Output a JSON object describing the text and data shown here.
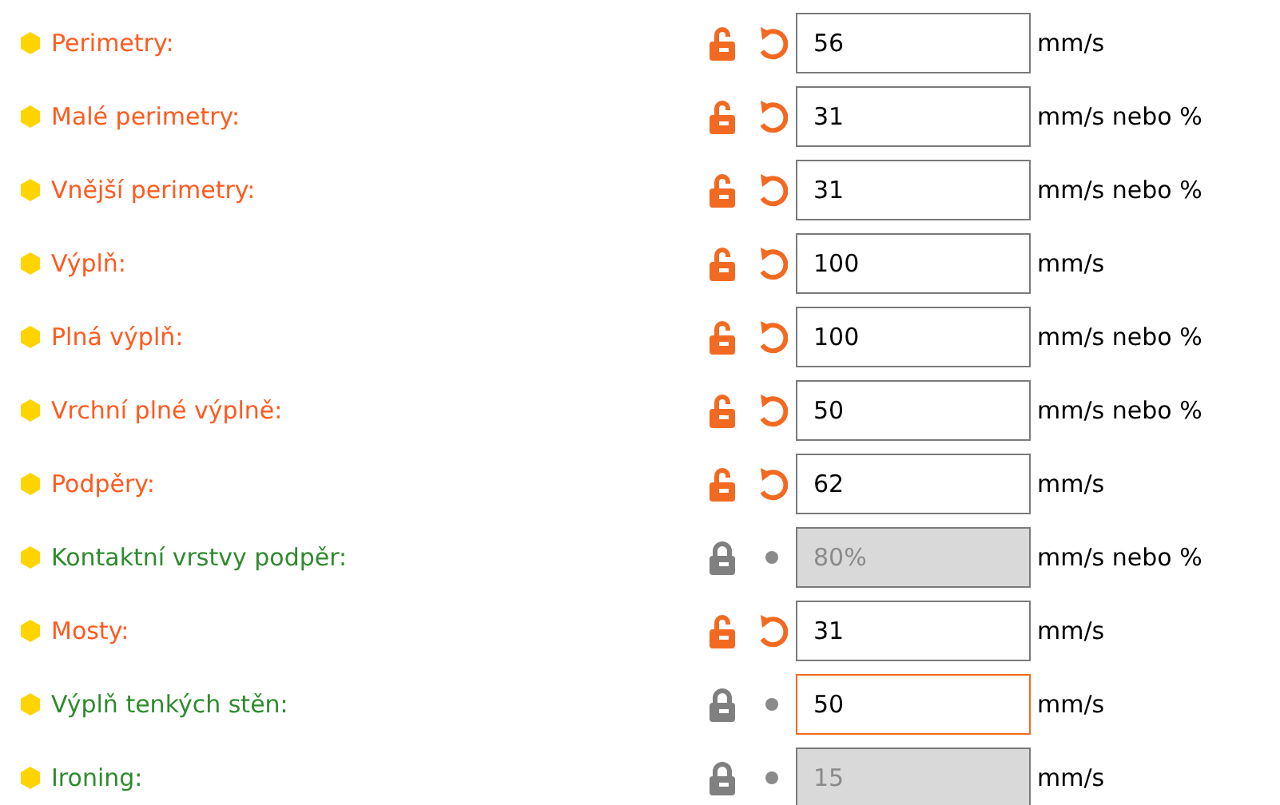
{
  "settings": [
    {
      "label": "Perimetry:",
      "modified": true,
      "value": "56",
      "disabled": false,
      "focused": false,
      "unit": "mm/s"
    },
    {
      "label": "Malé perimetry:",
      "modified": true,
      "value": "31",
      "disabled": false,
      "focused": false,
      "unit": "mm/s nebo %"
    },
    {
      "label": "Vnější perimetry:",
      "modified": true,
      "value": "31",
      "disabled": false,
      "focused": false,
      "unit": "mm/s nebo %"
    },
    {
      "label": "Výplň:",
      "modified": true,
      "value": "100",
      "disabled": false,
      "focused": false,
      "unit": "mm/s"
    },
    {
      "label": "Plná výplň:",
      "modified": true,
      "value": "100",
      "disabled": false,
      "focused": false,
      "unit": "mm/s nebo %"
    },
    {
      "label": "Vrchní plné výplně:",
      "modified": true,
      "value": "50",
      "disabled": false,
      "focused": false,
      "unit": "mm/s nebo %"
    },
    {
      "label": "Podpěry:",
      "modified": true,
      "value": "62",
      "disabled": false,
      "focused": false,
      "unit": "mm/s"
    },
    {
      "label": "Kontaktní vrstvy podpěr:",
      "modified": false,
      "value": "80%",
      "disabled": true,
      "focused": false,
      "unit": "mm/s nebo %"
    },
    {
      "label": "Mosty:",
      "modified": true,
      "value": "31",
      "disabled": false,
      "focused": false,
      "unit": "mm/s"
    },
    {
      "label": "Výplň tenkých stěn:",
      "modified": false,
      "value": "50",
      "disabled": false,
      "focused": true,
      "unit": "mm/s"
    },
    {
      "label": "Ironing:",
      "modified": false,
      "value": "15",
      "disabled": true,
      "focused": false,
      "unit": "mm/s"
    }
  ]
}
